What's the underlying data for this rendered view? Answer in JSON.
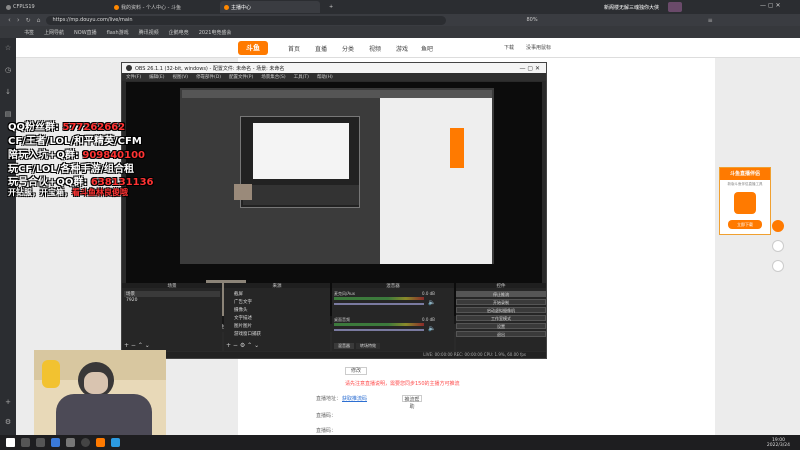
{
  "browser": {
    "tabs": [
      {
        "label": "CFPLS19",
        "active": false
      },
      {
        "label": "我的资料 - 个人中心 - 斗鱼",
        "active": false
      },
      {
        "label": "主播中心",
        "active": true
      }
    ],
    "address": "https://mp.douyu.com/live/main",
    "zoom": "80%",
    "tab_right_text": "新阁楼无解三魂独你大侠",
    "bookmarks": [
      "书签",
      "上网导航",
      "NOW直播",
      "flash游戏",
      "腾讯视频",
      "企鹅电竞",
      "2021电竞盛会"
    ]
  },
  "site": {
    "logo": "斗鱼",
    "nav": [
      "首页",
      "直播",
      "分类",
      "视频",
      "游戏",
      "鱼吧"
    ],
    "download": "下载",
    "user": "没事用鼠标"
  },
  "obs": {
    "title": "OBS 26.1.1 (32-bit, windows) - 配置文件: 未命名 - 场景: 未命名",
    "menu": [
      "文件(F)",
      "编辑(E)",
      "视图(V)",
      "停靠部件(D)",
      "配置文件(P)",
      "场景集合(S)",
      "工具(T)",
      "帮助(H)"
    ],
    "no_source": "未选择源",
    "props": "属性",
    "filters": "滤镜",
    "panels": {
      "scenes": "场景",
      "sources": "来源",
      "mixer": "混音器",
      "transitions": "转场特效",
      "controls": "控件"
    },
    "scenes": [
      "场景",
      "7920"
    ],
    "sources": [
      "截屏",
      "广告文字",
      "摄像头",
      "文字描述",
      "图片图片",
      "游戏窗口捕获"
    ],
    "mixer": [
      {
        "name": "麦克风/Aux",
        "db": "0.0 dB"
      },
      {
        "name": "桌面音频",
        "db": "0.0 dB"
      }
    ],
    "controls": [
      "停止推流",
      "开始录制",
      "启动虚拟摄像机",
      "工作室模式",
      "设置",
      "退出"
    ],
    "status": "LIVE: 00:00:00  REC: 00:00:00  CPU: 1.9%, 60.00 fps"
  },
  "overlay": {
    "qq_fans": [
      "QQ粉丝群: ",
      "577262662"
    ],
    "line2": "CF/王者/LOL/和平精英/CFM",
    "line3": [
      "陪玩入坑+Q群: ",
      "909840100"
    ],
    "line4": "玩CF/LOL/各种手游/组合租",
    "line5": [
      "玩号合伙+QQ群: ",
      "638131136"
    ],
    "line6": [
      "开钻服，开宝箱，",
      "看斗鱼林良俊哦"
    ]
  },
  "promo": {
    "title": "斗鱼直播伴侣",
    "subtitle": "新版斗鱼伴侣直播工具",
    "button": "立即下载"
  },
  "form": {
    "notice": "请先注意直播说明，需要您同步150的主播方可推流",
    "link1": "获取推流码",
    "link2": "推流帮助",
    "btn": "修改",
    "label1": "直播地址：",
    "label2": "直播码：",
    "label3": "直播码："
  },
  "taskbar": {
    "time": "19:00",
    "date": "2022/3/24"
  }
}
